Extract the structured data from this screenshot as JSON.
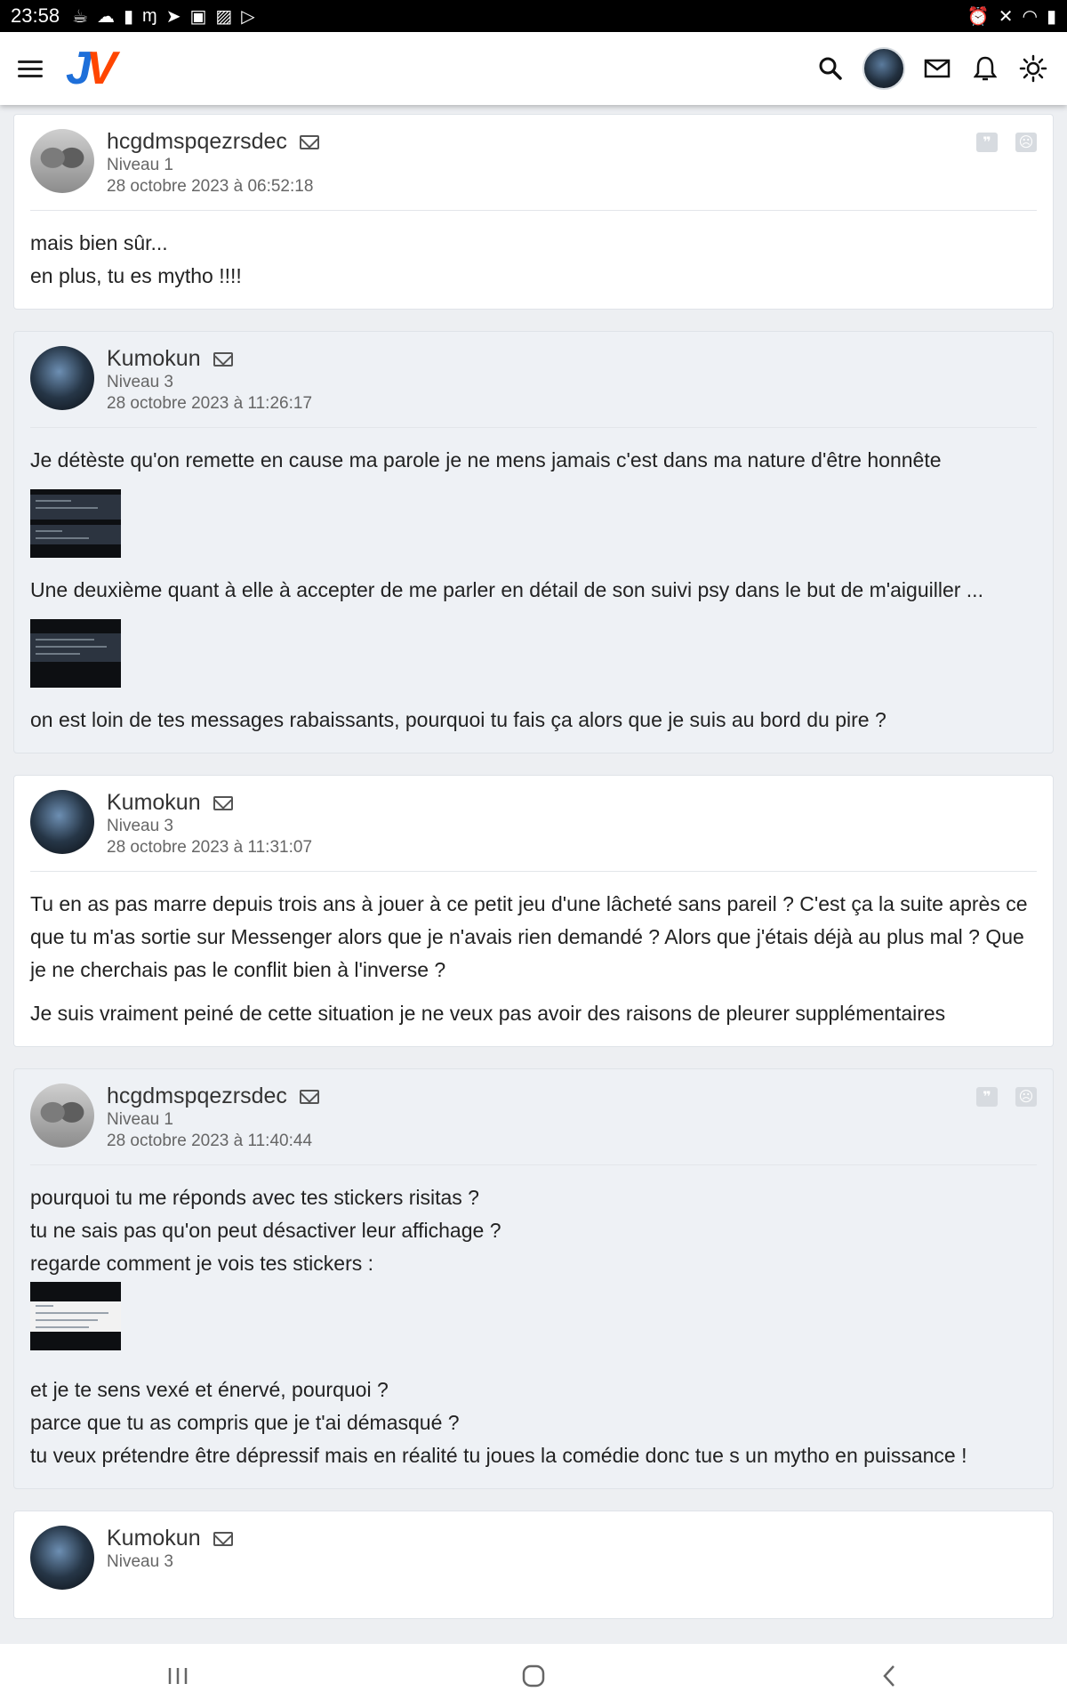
{
  "status": {
    "time": "23:58"
  },
  "header": {
    "logo_j": "J",
    "logo_v": "V"
  },
  "posts": [
    {
      "author": "hcgdmspqezrsdec",
      "level": "Niveau 1",
      "date": "28 octobre 2023 à 06:52:18",
      "lines": [
        "mais bien sûr...",
        "en plus, tu es mytho !!!!"
      ]
    },
    {
      "author": "Kumokun",
      "level": "Niveau 3",
      "date": "28 octobre 2023 à 11:26:17",
      "p1": "Je détèste qu'on remette en cause ma parole je ne mens jamais c'est dans ma nature d'être honnête",
      "p2": "Une deuxième quant à elle à accepter de me parler en détail de son suivi psy dans le but de m'aiguiller ...",
      "p3": "on est loin de tes messages rabaissants, pourquoi tu fais ça alors que je suis au bord du pire ?"
    },
    {
      "author": "Kumokun",
      "level": "Niveau 3",
      "date": "28 octobre 2023 à 11:31:07",
      "p1": "Tu en as pas marre depuis trois ans à jouer à ce petit jeu d'une lâcheté sans pareil ? C'est ça la suite après ce que tu m'as sortie sur Messenger alors que je n'avais rien demandé ? Alors que j'étais déjà au plus mal ? Que je ne cherchais pas le conflit bien à l'inverse ?",
      "p2": "Je suis vraiment peiné de cette situation je ne veux pas avoir des raisons de pleurer supplémentaires"
    },
    {
      "author": "hcgdmspqezrsdec",
      "level": "Niveau 1",
      "date": "28 octobre 2023 à 11:40:44",
      "l1": "pourquoi tu me réponds avec tes stickers risitas ?",
      "l2": "tu ne sais pas qu'on peut désactiver leur affichage ?",
      "l3": "regarde comment je vois tes stickers :",
      "l4": "et je te sens vexé et énervé, pourquoi ?",
      "l5": "parce que tu as compris que je t'ai démasqué ?",
      "l6": "tu veux prétendre être dépressif mais en réalité tu joues la comédie donc tue s un mytho en puissance !"
    },
    {
      "author": "Kumokun",
      "level": "Niveau 3"
    }
  ],
  "icons": {
    "quote": "❞",
    "sad": "☹"
  }
}
